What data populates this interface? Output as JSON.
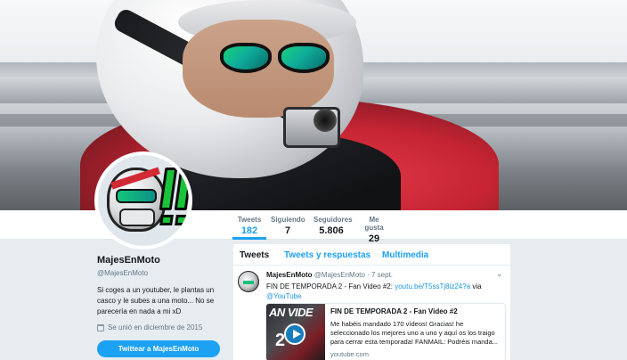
{
  "nav": {
    "stats": [
      {
        "label": "Tweets",
        "value": "182"
      },
      {
        "label": "Siguiendo",
        "value": "7"
      },
      {
        "label": "Seguidores",
        "value": "5.806"
      },
      {
        "label": "Me gusta",
        "value": "29"
      }
    ]
  },
  "profile": {
    "name": "MajesEnMoto",
    "handle": "@MajesEnMoto",
    "bio": "Si coges a un youtuber, le plantas un casco y le subes a una moto... No se parecería en nada a mi xD",
    "joined": "Se unió en diciembre de 2015",
    "tweet_button": "Twittear a MajesEnMoto"
  },
  "timeline": {
    "tabs": [
      "Tweets",
      "Tweets y respuestas",
      "Multimedia"
    ],
    "tweet": {
      "name": "MajesEnMoto",
      "handle": "@MajesEnMoto",
      "date": "· 7 sept.",
      "text": "FIN DE TEMPORADA 2 - Fan Video #2: ",
      "link": "youtu.be/T5ssTj8iz24?a",
      "via": " via",
      "mention": "@YouTube",
      "card": {
        "thumb_text": "AN VIDE",
        "thumb_num": "2",
        "title": "FIN DE TEMPORADA 2 - Fan Video #2",
        "description": "Me habéis mandado 170 vídeos! Gracias! he seleccionado los mejores uno a uno y aquí os los traigo para cerrar esta temporada! FANMAIL: Podréis manda...",
        "domain": "youtube.com"
      }
    }
  },
  "colors": {
    "accent": "#1da1f2",
    "background": "#e6ecf0"
  }
}
